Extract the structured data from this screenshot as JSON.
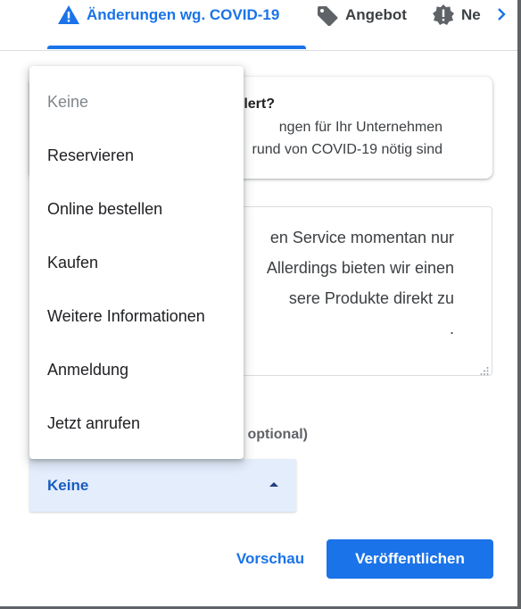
{
  "tabs": [
    {
      "label": "Änderungen wg. COVID-19",
      "icon": "warning-icon",
      "active": true
    },
    {
      "label": "Angebot",
      "icon": "tag-icon",
      "active": false
    },
    {
      "label": "Ne",
      "icon": "alert-badge-icon",
      "active": false
    }
  ],
  "info_card": {
    "title": "lert?",
    "line1": "ngen für Ihr Unternehmen",
    "line2": "rund von COVID-19 nötig sind"
  },
  "post_text": {
    "lines": [
      "en Service momentan nur",
      "Allerdings bieten wir einen",
      "sere Produkte direkt zu",
      "."
    ]
  },
  "button_section": {
    "label_fragment": "optional)",
    "selected_value": "Keine"
  },
  "dropdown": {
    "items": [
      {
        "label": "Keine",
        "disabled": true
      },
      {
        "label": "Reservieren",
        "disabled": false
      },
      {
        "label": "Online bestellen",
        "disabled": false
      },
      {
        "label": "Kaufen",
        "disabled": false
      },
      {
        "label": "Weitere Informationen",
        "disabled": false
      },
      {
        "label": "Anmeldung",
        "disabled": false
      },
      {
        "label": "Jetzt anrufen",
        "disabled": false
      }
    ]
  },
  "actions": {
    "preview_label": "Vorschau",
    "publish_label": "Veröffentlichen"
  },
  "colors": {
    "accent": "#1a73e8",
    "select_bg": "#e3edfc",
    "text_primary": "#202124",
    "text_muted": "#80868b"
  }
}
